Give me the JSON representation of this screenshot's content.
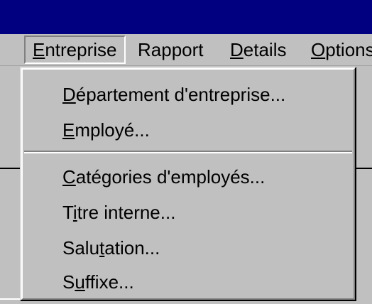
{
  "menubar": {
    "items": [
      {
        "pre": "",
        "u": "E",
        "post": "ntreprise"
      },
      {
        "pre": "Rapport",
        "u": "",
        "post": ""
      },
      {
        "pre": "",
        "u": "D",
        "post": "etails"
      },
      {
        "pre": "",
        "u": "O",
        "post": "ptions"
      }
    ]
  },
  "dropdown": {
    "items": [
      {
        "pre": "",
        "u": "D",
        "post": "épartement d'entreprise..."
      },
      {
        "pre": "",
        "u": "E",
        "post": "mployé..."
      },
      {
        "pre": "",
        "u": "C",
        "post": "atégories d'employés..."
      },
      {
        "pre": "T",
        "u": "i",
        "post": "tre interne..."
      },
      {
        "pre": "Salu",
        "u": "t",
        "post": "ation..."
      },
      {
        "pre": "S",
        "u": "u",
        "post": "ffixe..."
      }
    ]
  },
  "colors": {
    "titlebar": "#000080",
    "face": "#c0c0c0",
    "shadow": "#808080",
    "highlight": "#ffffff"
  }
}
